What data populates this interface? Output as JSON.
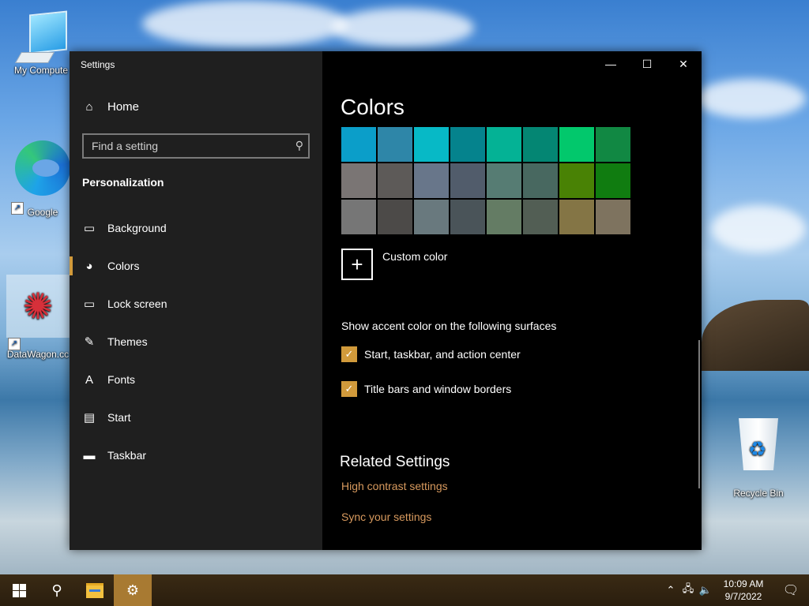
{
  "desktop": {
    "icons": [
      {
        "label": "My Compute"
      },
      {
        "label": "Google"
      },
      {
        "label": "DataWagon.cc"
      },
      {
        "label": "Recycle Bin"
      }
    ]
  },
  "window": {
    "title": "Settings",
    "controls": {
      "minimize": "—",
      "maximize": "☐",
      "close": "✕"
    }
  },
  "sidebar": {
    "home_label": "Home",
    "search_placeholder": "Find a setting",
    "section_title": "Personalization",
    "items": [
      {
        "label": "Background",
        "icon": "image-icon",
        "glyph": "▭"
      },
      {
        "label": "Colors",
        "icon": "palette-icon",
        "glyph": "◕",
        "active": true
      },
      {
        "label": "Lock screen",
        "icon": "lock-screen-icon",
        "glyph": "▭"
      },
      {
        "label": "Themes",
        "icon": "themes-icon",
        "glyph": "✎"
      },
      {
        "label": "Fonts",
        "icon": "fonts-icon",
        "glyph": "A"
      },
      {
        "label": "Start",
        "icon": "start-icon",
        "glyph": "▤"
      },
      {
        "label": "Taskbar",
        "icon": "taskbar-icon",
        "glyph": "▬"
      }
    ]
  },
  "main": {
    "title": "Colors",
    "swatches": [
      "#0b9ec9",
      "#2e86a8",
      "#07b9c6",
      "#05838d",
      "#04b295",
      "#048673",
      "#02c86c",
      "#118843",
      "#7a7574",
      "#5d5a58",
      "#68768a",
      "#515c6b",
      "#567c73",
      "#486860",
      "#498205",
      "#107c10",
      "#767676",
      "#4c4a48",
      "#69797e",
      "#4a5459",
      "#647c64",
      "#525e54",
      "#847545",
      "#7e735f"
    ],
    "custom_color_label": "Custom color",
    "surfaces_label": "Show accent color on the following surfaces",
    "checkbox_start": "Start, taskbar, and action center",
    "checkbox_title": "Title bars and window borders",
    "related_title": "Related Settings",
    "link_high_contrast": "High contrast settings",
    "link_sync": "Sync your settings"
  },
  "taskbar": {
    "time": "10:09 AM",
    "date": "9/7/2022"
  },
  "colors": {
    "accent": "#d19a3b",
    "link": "#d89a5e"
  }
}
